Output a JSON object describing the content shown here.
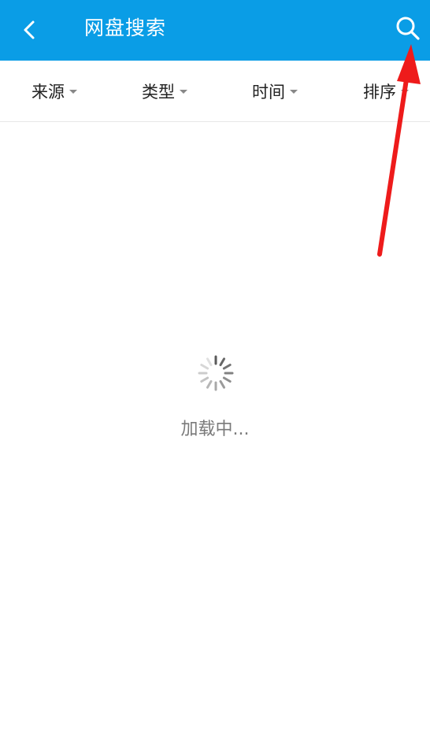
{
  "header": {
    "back_icon": "chevron-left-icon",
    "title": "网盘搜索",
    "search_icon": "search-icon",
    "background_color": "#0a9de6"
  },
  "filters": [
    {
      "label": "来源"
    },
    {
      "label": "类型"
    },
    {
      "label": "时间"
    },
    {
      "label": "排序"
    }
  ],
  "loading": {
    "icon": "spinner-icon",
    "text": "加载中..."
  },
  "annotation": {
    "type": "red-arrow",
    "color": "#ee1b1b"
  }
}
